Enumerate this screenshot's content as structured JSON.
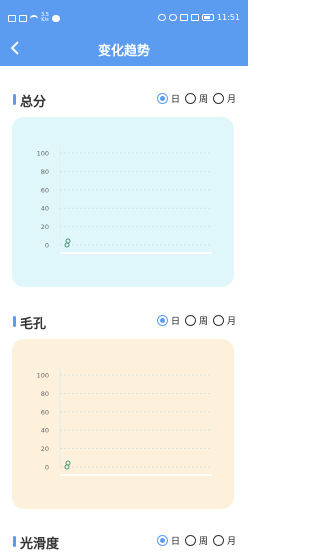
{
  "status_bar": {
    "time": "11:51",
    "net_speed": "3.5\nK/s"
  },
  "header": {
    "title": "变化趋势",
    "bg_color": "#5b9cf0"
  },
  "radio_options": [
    "日",
    "周",
    "月"
  ],
  "sections": [
    {
      "title": "总分",
      "selected": "日",
      "card_color": "#dff7fa",
      "chart_data": {
        "type": "line",
        "ylim": [
          0,
          100
        ],
        "y_ticks": [
          "100",
          "80",
          "60",
          "40",
          "20",
          "0"
        ],
        "grid": true,
        "series": [
          {
            "values": [
              0
            ]
          }
        ]
      }
    },
    {
      "title": "毛孔",
      "selected": "日",
      "card_color": "#fdf1dc",
      "chart_data": {
        "type": "line",
        "ylim": [
          0,
          100
        ],
        "y_ticks": [
          "100",
          "80",
          "60",
          "40",
          "20",
          "0"
        ],
        "grid": true,
        "series": [
          {
            "values": [
              0
            ]
          }
        ]
      }
    },
    {
      "title": "光滑度",
      "selected": "日"
    }
  ]
}
